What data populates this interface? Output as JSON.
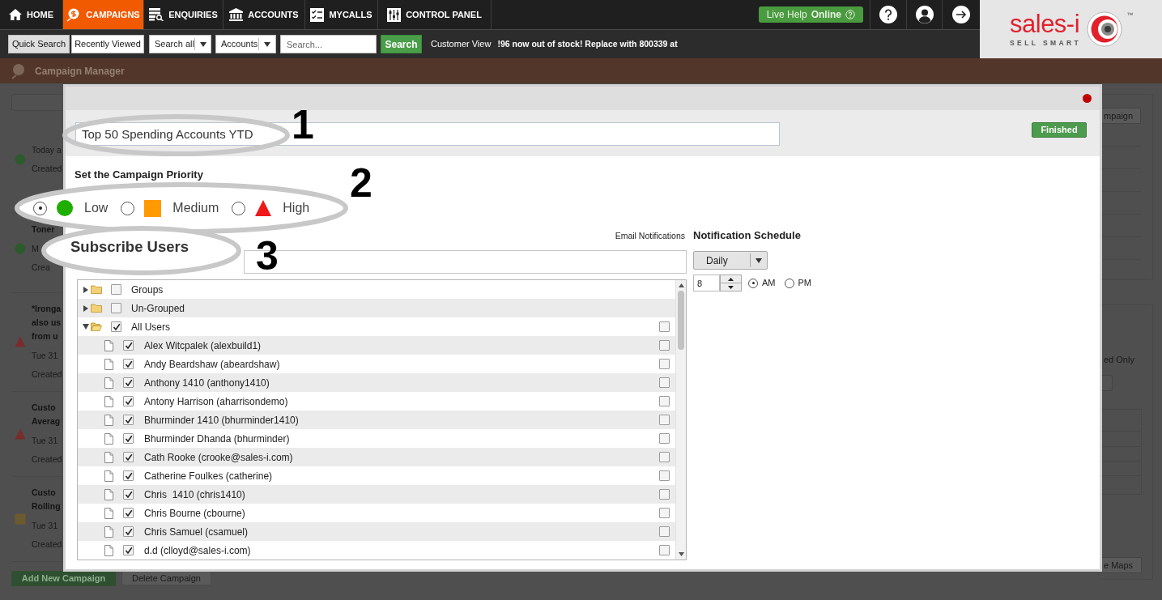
{
  "nav": {
    "tabs": [
      {
        "label": "HOME",
        "selected": false
      },
      {
        "label": "CAMPAIGNS",
        "selected": true
      },
      {
        "label": "ENQUIRIES",
        "selected": false
      },
      {
        "label": "ACCOUNTS",
        "selected": false
      },
      {
        "label": "MYCALLS",
        "selected": false
      },
      {
        "label": "CONTROL PANEL",
        "selected": false
      }
    ],
    "live_help": "Live Help **Online**"
  },
  "logo": {
    "name": "sales-i",
    "tagline": "SELL SMART",
    "trademark": "™"
  },
  "search_bar": {
    "modes": [
      {
        "label": "Quick Search",
        "selected": true
      },
      {
        "label": "Recently Viewed",
        "selected": false
      }
    ],
    "scope_select": "Search all",
    "type_select": "Accounts",
    "search_field": {
      "placeholder": "Search..."
    },
    "search_button": "Search",
    "customer_view": "Customer View",
    "ticker": "!96 now out of stock! Replace with 800339 at"
  },
  "page": {
    "title": "Campaign Manager",
    "campaigns": [
      {
        "kind": "low",
        "date": "Today a",
        "created": "Created"
      },
      {
        "kind": "low",
        "title": [
          "Toner"
        ],
        "date": "M",
        "created": "Crea"
      },
      {
        "kind": "high",
        "title": [
          "*Ironga",
          "also us",
          "from u"
        ],
        "date": "Tue 31",
        "created": "Created"
      },
      {
        "kind": "high",
        "title": [
          "Custo",
          "Averag"
        ],
        "date": "Tue 31",
        "created": "Created"
      },
      {
        "kind": "medium",
        "title": [
          "Custo",
          "Rolling"
        ],
        "date": "Tue 31",
        "created": "Created"
      }
    ],
    "add_button": "Add New Campaign",
    "delete_button": "Delete Campaign",
    "right_panel": {
      "top_button": "mpaign",
      "option_label": "ed Only",
      "bottom_button": "e Maps"
    }
  },
  "modal": {
    "title_field": {
      "value": "Top 50 Spending Accounts YTD"
    },
    "finished_button": "Finished",
    "priority": {
      "heading": "Set the Campaign Priority",
      "options": [
        {
          "kind": "low",
          "label": "Low",
          "selected": true
        },
        {
          "kind": "medium",
          "label": "Medium",
          "selected": false
        },
        {
          "kind": "high",
          "label": "High",
          "selected": false
        }
      ]
    },
    "subscribe": {
      "heading": "Subscribe Users",
      "email_column": "Email Notifications",
      "tree": [
        {
          "label": "Groups",
          "expanded": false,
          "checked": false
        },
        {
          "label": "Un-Grouped",
          "expanded": false,
          "checked": false
        },
        {
          "label": "All Users",
          "expanded": true,
          "checked": true,
          "email": false,
          "children": [
            {
              "label": "Alex Witcpalek (alexbuild1)",
              "checked": true,
              "email": false
            },
            {
              "label": "Andy Beardshaw (abeardshaw)",
              "checked": true,
              "email": false
            },
            {
              "label": "Anthony 1410 (anthony1410)",
              "checked": true,
              "email": false
            },
            {
              "label": "Antony Harrison (aharrisondemo)",
              "checked": true,
              "email": false
            },
            {
              "label": "Bhurminder 1410 (bhurminder1410)",
              "checked": true,
              "email": false
            },
            {
              "label": "Bhurminder Dhanda (bhurminder)",
              "checked": true,
              "email": false
            },
            {
              "label": "Cath Rooke (crooke@sales-i.com)",
              "checked": true,
              "email": false
            },
            {
              "label": "Catherine Foulkes (catherine)",
              "checked": true,
              "email": false
            },
            {
              "label": "Chris  1410 (chris1410)",
              "checked": true,
              "email": false
            },
            {
              "label": "Chris Bourne (cbourne)",
              "checked": true,
              "email": false
            },
            {
              "label": "Chris Samuel (csamuel)",
              "checked": true,
              "email": false
            },
            {
              "label": "d.d (clloyd@sales-i.com)",
              "checked": true,
              "email": false
            }
          ]
        }
      ]
    },
    "schedule": {
      "heading": "Notification Schedule",
      "frequency": "Daily",
      "hour": "8",
      "periods": [
        {
          "label": "AM",
          "selected": true
        },
        {
          "label": "PM",
          "selected": false
        }
      ]
    }
  },
  "callouts": [
    {
      "number": "1"
    },
    {
      "number": "2"
    },
    {
      "number": "3"
    }
  ]
}
